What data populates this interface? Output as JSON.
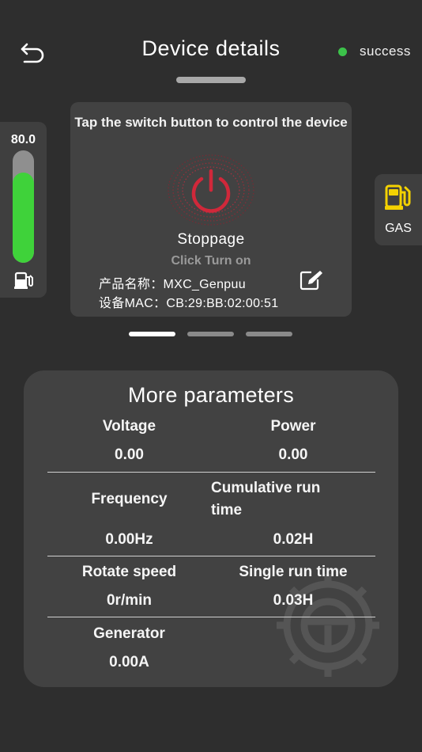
{
  "header": {
    "title": "Device details",
    "status_text": "success",
    "status_color": "#3cc24a",
    "back_icon": "back-arrow-icon"
  },
  "fuel_gauge": {
    "value_text": "80.0",
    "level_percent": 80,
    "fill_color": "#3fd23a",
    "icon": "fuel-pump-icon"
  },
  "control": {
    "hint": "Tap the switch button to control the device",
    "power_icon": "power-icon",
    "power_color": "#d0283a",
    "state": "Stoppage",
    "action": "Click Turn on",
    "product_name": "产品名称：MXC_Genpuu",
    "mac": "设备MAC：CB:29:BB:02:00:51",
    "edit_icon": "edit-icon"
  },
  "gas": {
    "label": "GAS",
    "icon": "gas-pump-icon",
    "icon_color": "#f4d200"
  },
  "pager": {
    "count": 3,
    "active": 1
  },
  "parameters": {
    "title": "More parameters",
    "voltage": {
      "label": "Voltage",
      "value": "0.00"
    },
    "power": {
      "label": "Power",
      "value": "0.00"
    },
    "frequency": {
      "label": "Frequency",
      "value": "0.00Hz"
    },
    "cumulative": {
      "label": "Cumulative run time",
      "value": "0.02H"
    },
    "rotate": {
      "label": "Rotate speed",
      "value": "0r/min"
    },
    "single": {
      "label": "Single run time",
      "value": "0.03H"
    },
    "generator": {
      "label": "Generator",
      "value": "0.00A"
    },
    "watermark_icon": "engine-gear-icon"
  }
}
